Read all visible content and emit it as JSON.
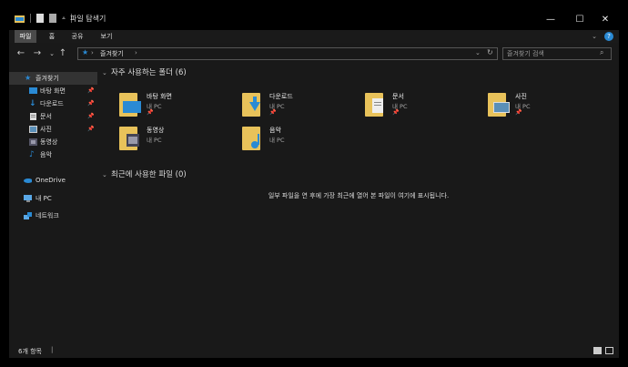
{
  "title": "파일 탐색기",
  "ribbon": {
    "tabs": [
      "파일",
      "홈",
      "공유",
      "보기"
    ]
  },
  "address": {
    "path": "즐겨찾기",
    "sep": "›"
  },
  "search": {
    "placeholder": "즐겨찾기 검색"
  },
  "sidebar": {
    "items": [
      {
        "label": "즐겨찾기",
        "icon": "star-icon"
      },
      {
        "label": "바탕 화면",
        "icon": "desktop-icon"
      },
      {
        "label": "다운로드",
        "icon": "download-icon"
      },
      {
        "label": "문서",
        "icon": "document-icon"
      },
      {
        "label": "사진",
        "icon": "pictures-icon"
      },
      {
        "label": "동영상",
        "icon": "video-icon"
      },
      {
        "label": "음악",
        "icon": "music-icon"
      },
      {
        "label": "OneDrive",
        "icon": "cloud-icon"
      },
      {
        "label": "내 PC",
        "icon": "pc-icon"
      },
      {
        "label": "네트워크",
        "icon": "network-icon"
      }
    ]
  },
  "frequent": {
    "header": "자주 사용하는 폴더 (6)",
    "folders": [
      {
        "name": "바탕 화면",
        "location": "내 PC",
        "pinned": true
      },
      {
        "name": "다운로드",
        "location": "내 PC",
        "pinned": true
      },
      {
        "name": "문서",
        "location": "내 PC",
        "pinned": true
      },
      {
        "name": "사진",
        "location": "내 PC",
        "pinned": true
      },
      {
        "name": "동영상",
        "location": "내 PC",
        "pinned": false
      },
      {
        "name": "음악",
        "location": "내 PC",
        "pinned": false
      }
    ]
  },
  "recent": {
    "header": "최근에 사용한 파일 (0)",
    "empty_message": "일부 파일을 연 후에 가장 최근에 열어 본 파일이 여기에 표시됩니다."
  },
  "status": {
    "text": "6개 항목"
  },
  "colors": {
    "accent": "#2a8ad4",
    "folder": "#e8c25a",
    "background": "#191919"
  }
}
